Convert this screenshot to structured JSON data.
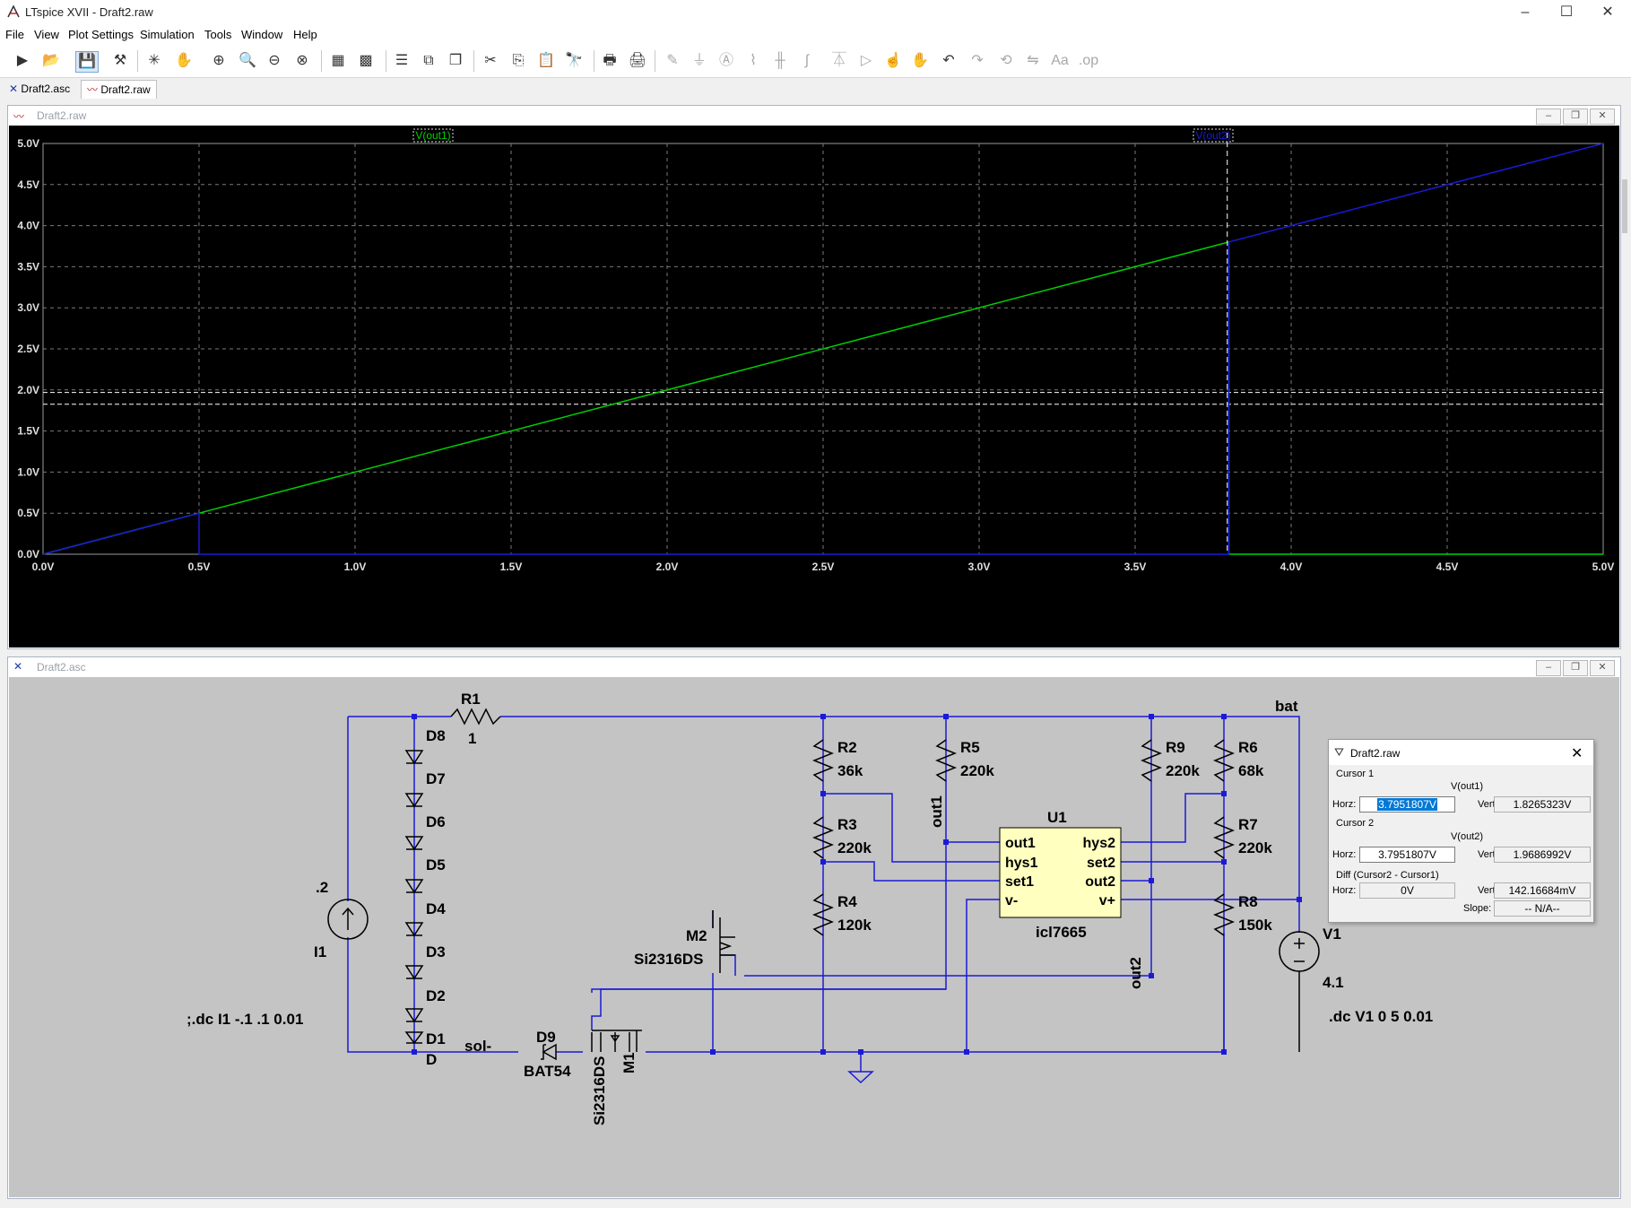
{
  "window": {
    "title": "LTspice XVII - Draft2.raw",
    "minimize": "–",
    "maximize": "☐",
    "close": "✕"
  },
  "menu": [
    "File",
    "View",
    "Plot Settings",
    "Simulation",
    "Tools",
    "Window",
    "Help"
  ],
  "toolbar_icons": [
    "run-icon",
    "open-icon",
    "save-icon",
    "control-panel-icon",
    "autorange-icon",
    "pan-icon",
    "zoom-in-icon",
    "zoom-area-icon",
    "zoom-out-icon",
    "zoom-full-icon",
    "add-plot-pane-icon",
    "delete-pane-icon",
    "tile-horizontal-icon",
    "tile-vertical-icon",
    "cascade-icon",
    "cut-icon",
    "copy-icon",
    "paste-icon",
    "find-icon",
    "print-icon",
    "print-preview-icon",
    "wire-icon",
    "ground-icon",
    "label-icon",
    "resistor-icon",
    "capacitor-icon",
    "inductor-icon",
    "diode-icon",
    "component-icon",
    "move-icon",
    "drag-icon",
    "undo-icon",
    "redo-icon",
    "rotate-icon",
    "mirror-icon",
    "text-icon",
    "spice-directive-icon"
  ],
  "tabs": [
    {
      "label": "Draft2.asc",
      "icon": "schematic-icon"
    },
    {
      "label": "Draft2.raw",
      "icon": "waveform-icon"
    }
  ],
  "plot_window": {
    "title": "Draft2.raw"
  },
  "schematic_window": {
    "title": "Draft2.asc"
  },
  "chart_data": {
    "type": "line",
    "xlim": [
      0,
      5
    ],
    "ylim": [
      0,
      5
    ],
    "x_ticks": [
      "0.0V",
      "0.5V",
      "1.0V",
      "1.5V",
      "2.0V",
      "2.5V",
      "3.0V",
      "3.5V",
      "4.0V",
      "4.5V",
      "5.0V"
    ],
    "y_ticks": [
      "0.0V",
      "0.5V",
      "1.0V",
      "1.5V",
      "2.0V",
      "2.5V",
      "3.0V",
      "3.5V",
      "4.0V",
      "4.5V",
      "5.0V"
    ],
    "grid": true,
    "background": "#000000",
    "series": [
      {
        "name": "V(out1)",
        "color": "#00d000",
        "x": [
          0,
          0.5,
          0.5,
          3.8,
          3.8,
          5.0
        ],
        "y": [
          0,
          0.5,
          0.5,
          3.8,
          0,
          0
        ]
      },
      {
        "name": "V(out2)",
        "color": "#1a1ad8",
        "x": [
          0,
          0.5,
          0.5,
          3.8,
          3.8,
          5.0
        ],
        "y": [
          0,
          0.5,
          0,
          0,
          3.8,
          5.0
        ]
      }
    ],
    "cursor_x": 3.7951807,
    "cursor_levels": [
      1.8265323,
      1.9686992
    ]
  },
  "cursor_dialog": {
    "title": "Draft2.raw",
    "cursor1": {
      "label": "Cursor 1",
      "trace": "V(out1)",
      "horz_label": "Horz:",
      "horz": "3.7951807V",
      "vert_label": "Vert:",
      "vert": "1.8265323V"
    },
    "cursor2": {
      "label": "Cursor 2",
      "trace": "V(out2)",
      "horz_label": "Horz:",
      "horz": "3.7951807V",
      "vert_label": "Vert:",
      "vert": "1.9686992V"
    },
    "diff": {
      "label": "Diff (Cursor2 - Cursor1)",
      "horz_label": "Horz:",
      "horz": "0V",
      "vert_label": "Vert:",
      "vert": "142.16684mV",
      "slope_label": "Slope:",
      "slope": "-- N/A--"
    }
  },
  "schematic": {
    "components": {
      "R1": {
        "name": "R1",
        "value": "1"
      },
      "R2": {
        "name": "R2",
        "value": "36k"
      },
      "R3": {
        "name": "R3",
        "value": "220k"
      },
      "R4": {
        "name": "R4",
        "value": "120k"
      },
      "R5": {
        "name": "R5",
        "value": "220k"
      },
      "R6": {
        "name": "R6",
        "value": "68k"
      },
      "R7": {
        "name": "R7",
        "value": "220k"
      },
      "R8": {
        "name": "R8",
        "value": "150k"
      },
      "R9": {
        "name": "R9",
        "value": "220k"
      },
      "U1": {
        "name": "U1",
        "model": "icl7665",
        "pins": [
          "out1",
          "hys1",
          "set1",
          "v-",
          "hys2",
          "set2",
          "out2",
          "v+"
        ]
      },
      "M2": {
        "name": "M2",
        "model": "Si2316DS"
      },
      "M1": {
        "name": "M1",
        "model": "Si2316DS"
      },
      "D9": {
        "name": "D9",
        "model": "BAT54"
      },
      "I1": {
        "name": "I1",
        "value": ".2"
      },
      "V1": {
        "name": "V1",
        "value": "4.1"
      },
      "diodes": [
        "D8",
        "D7",
        "D6",
        "D5",
        "D4",
        "D3",
        "D2",
        "D1",
        "D"
      ]
    },
    "net_labels": [
      "bat",
      "sol-",
      "out1",
      "out2"
    ],
    "directives": [
      ";.dc I1 -.1 .1 0.01",
      ".dc V1 0 5 0.01"
    ]
  }
}
